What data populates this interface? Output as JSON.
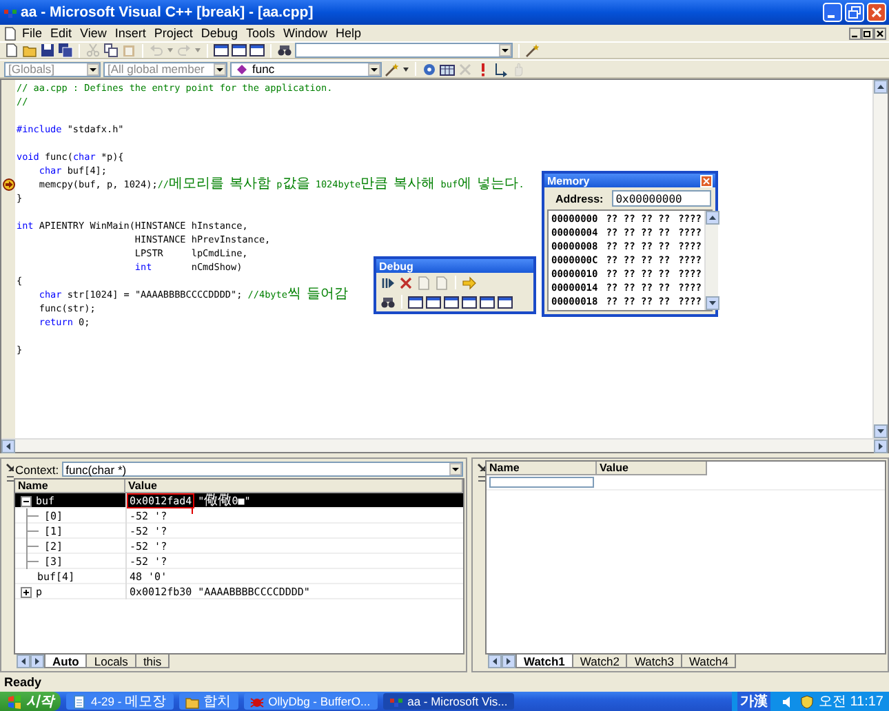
{
  "window": {
    "title": "aa - Microsoft Visual C++ [break] - [aa.cpp]"
  },
  "menu": [
    {
      "label": "File"
    },
    {
      "label": "Edit"
    },
    {
      "label": "View"
    },
    {
      "label": "Insert"
    },
    {
      "label": "Project"
    },
    {
      "label": "Debug"
    },
    {
      "label": "Tools"
    },
    {
      "label": "Window"
    },
    {
      "label": "Help"
    }
  ],
  "scope_bar": {
    "combos": [
      {
        "kind": "scope",
        "text": "[Globals]",
        "disabled": true
      },
      {
        "kind": "scope",
        "text": "[All global member",
        "disabled": true
      },
      {
        "kind": "function",
        "text": "func",
        "disabled": false
      }
    ]
  },
  "editor": {
    "lines": [
      {
        "kind": "code",
        "current": false,
        "tokens": [
          {
            "kind": "comment",
            "text": "// aa.cpp : Defines the entry point for the application."
          }
        ]
      },
      {
        "kind": "code",
        "current": false,
        "tokens": [
          {
            "kind": "comment",
            "text": "//"
          }
        ]
      },
      {
        "kind": "blank"
      },
      {
        "kind": "code",
        "current": false,
        "tokens": [
          {
            "kind": "keyword",
            "text": "#include"
          },
          {
            "kind": "plain",
            "text": " \"stdafx.h\""
          }
        ]
      },
      {
        "kind": "blank"
      },
      {
        "kind": "code",
        "current": false,
        "tokens": [
          {
            "kind": "keyword",
            "text": "void"
          },
          {
            "kind": "plain",
            "text": " func("
          },
          {
            "kind": "keyword",
            "text": "char"
          },
          {
            "kind": "plain",
            "text": " *p){"
          }
        ]
      },
      {
        "kind": "code",
        "current": false,
        "tokens": [
          {
            "kind": "keyword",
            "text": "    char"
          },
          {
            "kind": "plain",
            "text": " buf[4];"
          }
        ]
      },
      {
        "kind": "code",
        "current": true,
        "tokens": [
          {
            "kind": "plain",
            "text": "    memcpy(buf, p, 1024);"
          },
          {
            "kind": "comment",
            "text": "//메모리를 복사함 p값을 1024byte만큼 복사해 buf에 넣는다."
          }
        ]
      },
      {
        "kind": "code",
        "current": false,
        "tokens": [
          {
            "kind": "plain",
            "text": "}"
          }
        ]
      },
      {
        "kind": "blank"
      },
      {
        "kind": "code",
        "current": false,
        "tokens": [
          {
            "kind": "keyword",
            "text": "int"
          },
          {
            "kind": "plain",
            "text": " APIENTRY WinMain(HINSTANCE hInstance,"
          }
        ]
      },
      {
        "kind": "code",
        "current": false,
        "tokens": [
          {
            "kind": "plain",
            "text": "                     HINSTANCE hPrevInstance,"
          }
        ]
      },
      {
        "kind": "code",
        "current": false,
        "tokens": [
          {
            "kind": "plain",
            "text": "                     LPSTR     lpCmdLine,"
          }
        ]
      },
      {
        "kind": "code",
        "current": false,
        "tokens": [
          {
            "kind": "keyword",
            "text": "                     int"
          },
          {
            "kind": "plain",
            "text": "       nCmdShow)"
          }
        ]
      },
      {
        "kind": "code",
        "current": false,
        "tokens": [
          {
            "kind": "plain",
            "text": "{"
          }
        ]
      },
      {
        "kind": "code",
        "current": false,
        "tokens": [
          {
            "kind": "keyword",
            "text": "    char"
          },
          {
            "kind": "plain",
            "text": " str[1024] = \"AAAABBBBCCCCDDDD\"; "
          },
          {
            "kind": "comment",
            "text": "//4byte씩 들어감"
          }
        ]
      },
      {
        "kind": "code",
        "current": false,
        "tokens": [
          {
            "kind": "plain",
            "text": "    func(str);"
          }
        ]
      },
      {
        "kind": "code",
        "current": false,
        "tokens": [
          {
            "kind": "keyword",
            "text": "    return"
          },
          {
            "kind": "plain",
            "text": " 0;"
          }
        ]
      },
      {
        "kind": "blank"
      },
      {
        "kind": "code",
        "current": false,
        "tokens": [
          {
            "kind": "plain",
            "text": "}"
          }
        ]
      }
    ]
  },
  "memory_window": {
    "title": "Memory",
    "address_label": "Address:",
    "address": "0x00000000",
    "rows": [
      {
        "address": "00000000",
        "bytes": "?? ?? ?? ??",
        "chars": "????"
      },
      {
        "address": "00000004",
        "bytes": "?? ?? ?? ??",
        "chars": "????"
      },
      {
        "address": "00000008",
        "bytes": "?? ?? ?? ??",
        "chars": "????"
      },
      {
        "address": "0000000C",
        "bytes": "?? ?? ?? ??",
        "chars": "????"
      },
      {
        "address": "00000010",
        "bytes": "?? ?? ?? ??",
        "chars": "????"
      },
      {
        "address": "00000014",
        "bytes": "?? ?? ?? ??",
        "chars": "????"
      },
      {
        "address": "00000018",
        "bytes": "?? ?? ?? ??",
        "chars": "????"
      }
    ]
  },
  "debug_window": {
    "title": "Debug"
  },
  "variables": {
    "context_label": "Context:",
    "context": "func(char *)",
    "columns": [
      "Name",
      "Value"
    ],
    "rows": [
      {
        "kind": "node",
        "name": "buf",
        "value": "0x0012fad4 \"儆儆0■\"",
        "expanded": true,
        "selected": true,
        "highlighted": true,
        "children": [
          {
            "name": "[0]",
            "value": "-52 '?",
            "selected": false
          },
          {
            "name": "[1]",
            "value": "-52 '?",
            "selected": false
          },
          {
            "name": "[2]",
            "value": "-52 '?",
            "selected": false
          },
          {
            "name": "[3]",
            "value": "-52 '?",
            "selected": false
          }
        ]
      },
      {
        "kind": "leaf",
        "name": "buf[4]",
        "value": "48 '0'",
        "selected": false,
        "highlighted": false
      },
      {
        "kind": "node",
        "name": "p",
        "value": "0x0012fb30 \"AAAABBBBCCCCDDDD\"",
        "expanded": false,
        "selected": false,
        "highlighted": false
      }
    ],
    "tabs": [
      {
        "label": "Auto",
        "selected": true
      },
      {
        "label": "Locals",
        "selected": false
      },
      {
        "label": "this",
        "selected": false
      }
    ]
  },
  "watch": {
    "columns": [
      "Name",
      "Value"
    ],
    "tabs": [
      {
        "label": "Watch1",
        "selected": true
      },
      {
        "label": "Watch2",
        "selected": false
      },
      {
        "label": "Watch3",
        "selected": false
      },
      {
        "label": "Watch4",
        "selected": false
      }
    ]
  },
  "status_bar": {
    "text": "Ready"
  },
  "taskbar": {
    "start": "시작",
    "tasks": [
      {
        "label": "4-29 - 메모장",
        "selected": false
      },
      {
        "label": "합치",
        "selected": false
      },
      {
        "label": "OllyDbg - BufferO...",
        "selected": false
      },
      {
        "label": "aa - Microsoft Vis...",
        "selected": true
      }
    ],
    "input_method": "가漢",
    "clock": "오전 11:17"
  }
}
